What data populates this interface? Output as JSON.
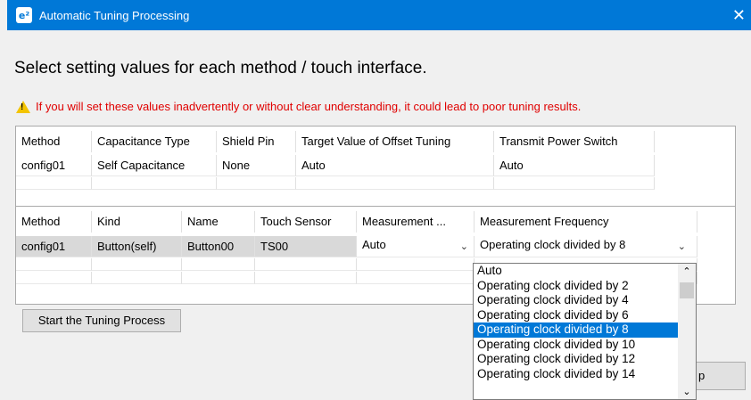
{
  "window": {
    "title": "Automatic Tuning Processing",
    "app_icon": "e²",
    "close_glyph": "✕"
  },
  "heading": "Select setting values for each method / touch interface.",
  "warning": "If you will set these values inadvertently or without clear understanding, it could lead to poor tuning results.",
  "table1": {
    "headers": [
      "Method",
      "Capacitance Type",
      "Shield Pin",
      "Target Value of Offset Tuning",
      "Transmit Power Switch"
    ],
    "row": [
      "config01",
      "Self Capacitance",
      "None",
      "Auto",
      "Auto"
    ]
  },
  "table2": {
    "headers": [
      "Method",
      "Kind",
      "Name",
      "Touch Sensor",
      "Measurement ...",
      "Measurement Frequency"
    ],
    "row": [
      "config01",
      "Button(self)",
      "Button00",
      "TS00",
      "Auto",
      "Operating clock divided by 8"
    ]
  },
  "buttons": {
    "start": "Start the Tuning Process",
    "help_partial": "p"
  },
  "frequency_options": [
    "Auto",
    "Operating clock divided by 2",
    "Operating clock divided by 4",
    "Operating clock divided by 6",
    "Operating clock divided by 8",
    "Operating clock divided by 10",
    "Operating clock divided by 12",
    "Operating clock divided by 14"
  ],
  "selected_option_index": 4,
  "colors": {
    "title_bar": "#0078d7",
    "warning_text": "#e00000",
    "selection": "#0078d7"
  }
}
